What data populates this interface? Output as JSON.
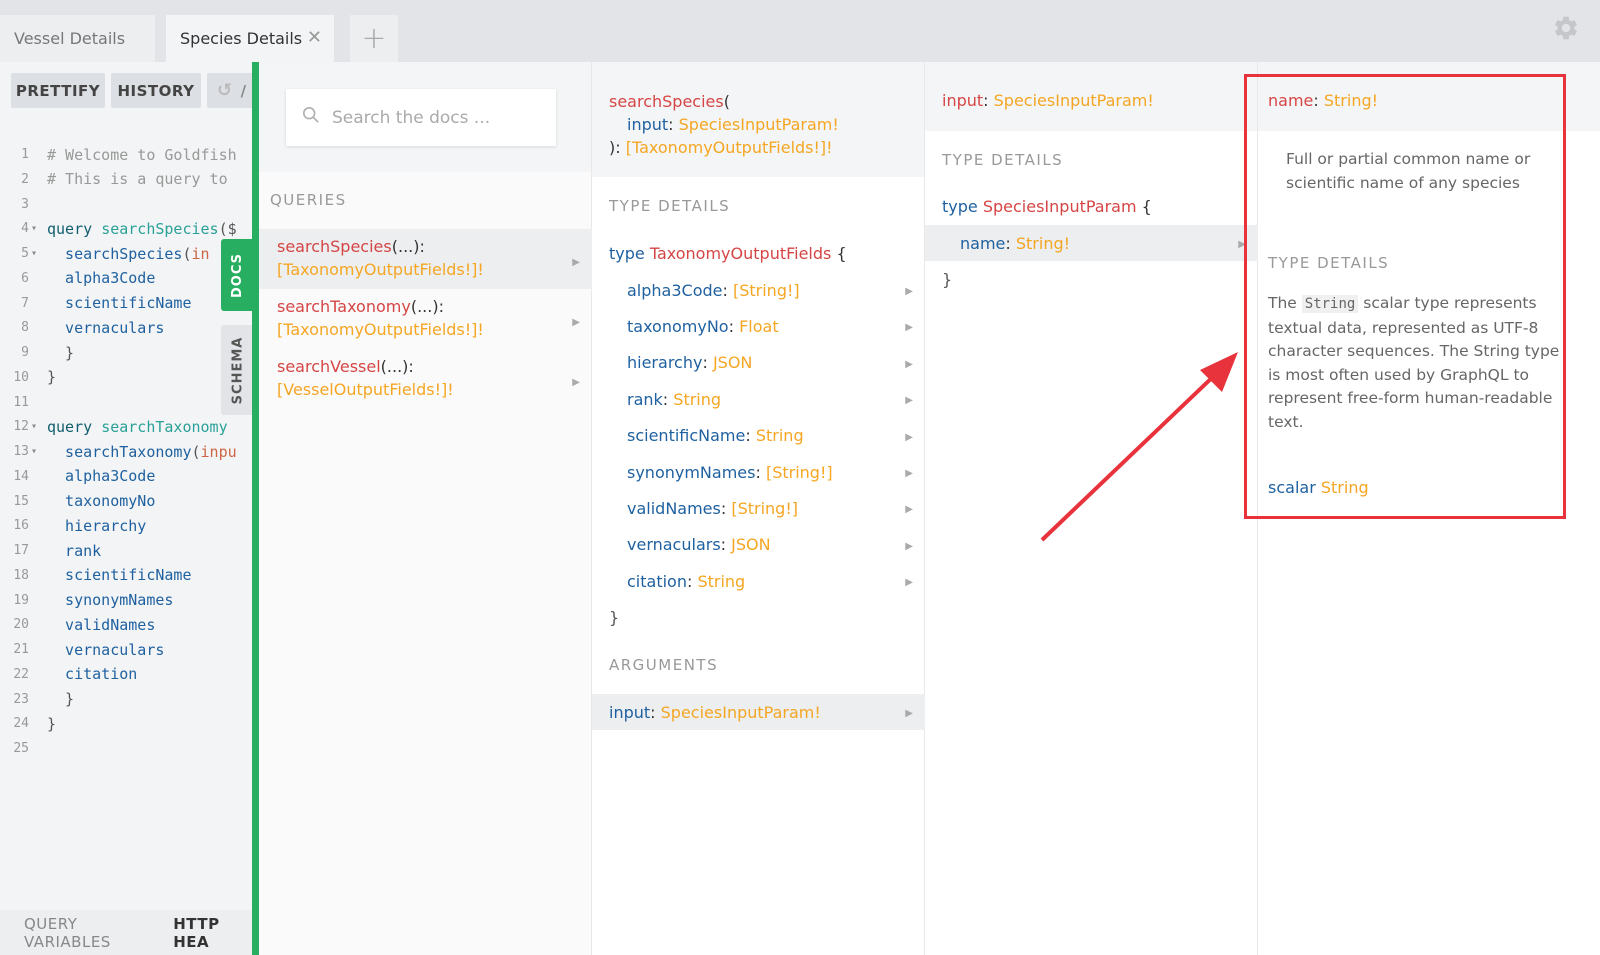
{
  "tabs": [
    {
      "label": "Vessel Details"
    },
    {
      "label": "Species Details",
      "close": "✕"
    }
  ],
  "tab_add": "+",
  "settings_icon": "gear-icon",
  "toolbar": {
    "prettify": "PRETTIFY",
    "history": "HISTORY",
    "undo": "/"
  },
  "code_lines": [
    {
      "n": "1",
      "parts": [
        {
          "t": "comment",
          "v": "# Welcome to Goldfish"
        }
      ]
    },
    {
      "n": "2",
      "parts": [
        {
          "t": "comment",
          "v": "# This is a query to"
        }
      ]
    },
    {
      "n": "3",
      "parts": []
    },
    {
      "n": "4",
      "fold": "▾",
      "parts": [
        {
          "t": "kw",
          "v": "query "
        },
        {
          "t": "def",
          "v": "searchSpecies"
        },
        {
          "t": "punct",
          "v": "($"
        }
      ]
    },
    {
      "n": "5",
      "fold": "▾",
      "parts": [
        {
          "t": "field",
          "v": "  searchSpecies"
        },
        {
          "t": "punct",
          "v": "("
        },
        {
          "t": "attr",
          "v": "in"
        }
      ]
    },
    {
      "n": "6",
      "parts": [
        {
          "t": "field",
          "v": "  alpha3Code"
        }
      ]
    },
    {
      "n": "7",
      "parts": [
        {
          "t": "field",
          "v": "  scientificName"
        }
      ]
    },
    {
      "n": "8",
      "parts": [
        {
          "t": "field",
          "v": "  vernaculars"
        }
      ]
    },
    {
      "n": "9",
      "parts": [
        {
          "t": "punct",
          "v": "  }"
        }
      ]
    },
    {
      "n": "10",
      "parts": [
        {
          "t": "punct",
          "v": "}"
        }
      ]
    },
    {
      "n": "11",
      "parts": []
    },
    {
      "n": "12",
      "fold": "▾",
      "parts": [
        {
          "t": "kw",
          "v": "query "
        },
        {
          "t": "def",
          "v": "searchTaxonomy"
        }
      ]
    },
    {
      "n": "13",
      "fold": "▾",
      "parts": [
        {
          "t": "field",
          "v": "  searchTaxonomy"
        },
        {
          "t": "punct",
          "v": "("
        },
        {
          "t": "attr",
          "v": "inpu"
        }
      ]
    },
    {
      "n": "14",
      "parts": [
        {
          "t": "field",
          "v": "  alpha3Code"
        }
      ]
    },
    {
      "n": "15",
      "parts": [
        {
          "t": "field",
          "v": "  taxonomyNo"
        }
      ]
    },
    {
      "n": "16",
      "parts": [
        {
          "t": "field",
          "v": "  hierarchy"
        }
      ]
    },
    {
      "n": "17",
      "parts": [
        {
          "t": "field",
          "v": "  rank"
        }
      ]
    },
    {
      "n": "18",
      "parts": [
        {
          "t": "field",
          "v": "  scientificName"
        }
      ]
    },
    {
      "n": "19",
      "parts": [
        {
          "t": "field",
          "v": "  synonymNames"
        }
      ]
    },
    {
      "n": "20",
      "parts": [
        {
          "t": "field",
          "v": "  validNames"
        }
      ]
    },
    {
      "n": "21",
      "parts": [
        {
          "t": "field",
          "v": "  vernaculars"
        }
      ]
    },
    {
      "n": "22",
      "parts": [
        {
          "t": "field",
          "v": "  citation"
        }
      ]
    },
    {
      "n": "23",
      "parts": [
        {
          "t": "punct",
          "v": "  }"
        }
      ]
    },
    {
      "n": "24",
      "parts": [
        {
          "t": "punct",
          "v": "}"
        }
      ]
    },
    {
      "n": "25",
      "parts": []
    }
  ],
  "bottom_bar": {
    "query_variables": "QUERY VARIABLES",
    "http_headers": "HTTP HEA"
  },
  "side_tabs": {
    "docs": "DOCS",
    "schema": "SCHEMA"
  },
  "docs": {
    "search_placeholder": "Search the docs ...",
    "col1": {
      "section": "QUERIES",
      "queries": [
        {
          "name": "searchSpecies",
          "args": "(...):",
          "type": "[TaxonomyOutputFields!]!"
        },
        {
          "name": "searchTaxonomy",
          "args": "(...):",
          "type": "[TaxonomyOutputFields!]!"
        },
        {
          "name": "searchVessel",
          "args": "(...):",
          "type": "[VesselOutputFields!]!"
        }
      ]
    },
    "col2": {
      "sig_name": "searchSpecies",
      "sig_open": "(",
      "sig_arg": "input",
      "sig_colon": ":",
      "sig_arg_type": "SpeciesInputParam!",
      "sig_close": "):",
      "sig_return": "[TaxonomyOutputFields!]!",
      "type_details": "TYPE DETAILS",
      "type_kw": "type",
      "type_name": "TaxonomyOutputFields",
      "open_brace": "{",
      "close_brace": "}",
      "fields": [
        {
          "name": "alpha3Code",
          "type": "[String!]"
        },
        {
          "name": "taxonomyNo",
          "type": "Float"
        },
        {
          "name": "hierarchy",
          "type": "JSON"
        },
        {
          "name": "rank",
          "type": "String"
        },
        {
          "name": "scientificName",
          "type": "String"
        },
        {
          "name": "synonymNames",
          "type": "[String!]"
        },
        {
          "name": "validNames",
          "type": "[String!]"
        },
        {
          "name": "vernaculars",
          "type": "JSON"
        },
        {
          "name": "citation",
          "type": "String"
        }
      ],
      "arguments": "ARGUMENTS",
      "arg_name": "input",
      "arg_type": "SpeciesInputParam!"
    },
    "col3": {
      "header_name": "input",
      "header_type": "SpeciesInputParam!",
      "type_details": "TYPE DETAILS",
      "type_kw": "type",
      "type_name": "SpeciesInputParam",
      "open_brace": "{",
      "close_brace": "}",
      "field_name": "name",
      "field_type": "String!"
    },
    "col4": {
      "header_name": "name",
      "header_type": "String!",
      "description": "Full or partial common name or scientific name of any species",
      "type_details": "TYPE DETAILS",
      "type_desc_pre": "The ",
      "type_desc_code": "String",
      "type_desc_post": " scalar type represents textual data, represented as UTF-8 character sequences. The String type is most often used by GraphQL to represent free-form human-readable text.",
      "scalar_kw": "scalar",
      "scalar_name": "String"
    }
  },
  "colors": {
    "accent_green": "#27ae60",
    "field_name": "#1f61a0",
    "type_orange": "#f5a623",
    "query_red": "#d64545",
    "annotation_red": "#e8333d"
  }
}
